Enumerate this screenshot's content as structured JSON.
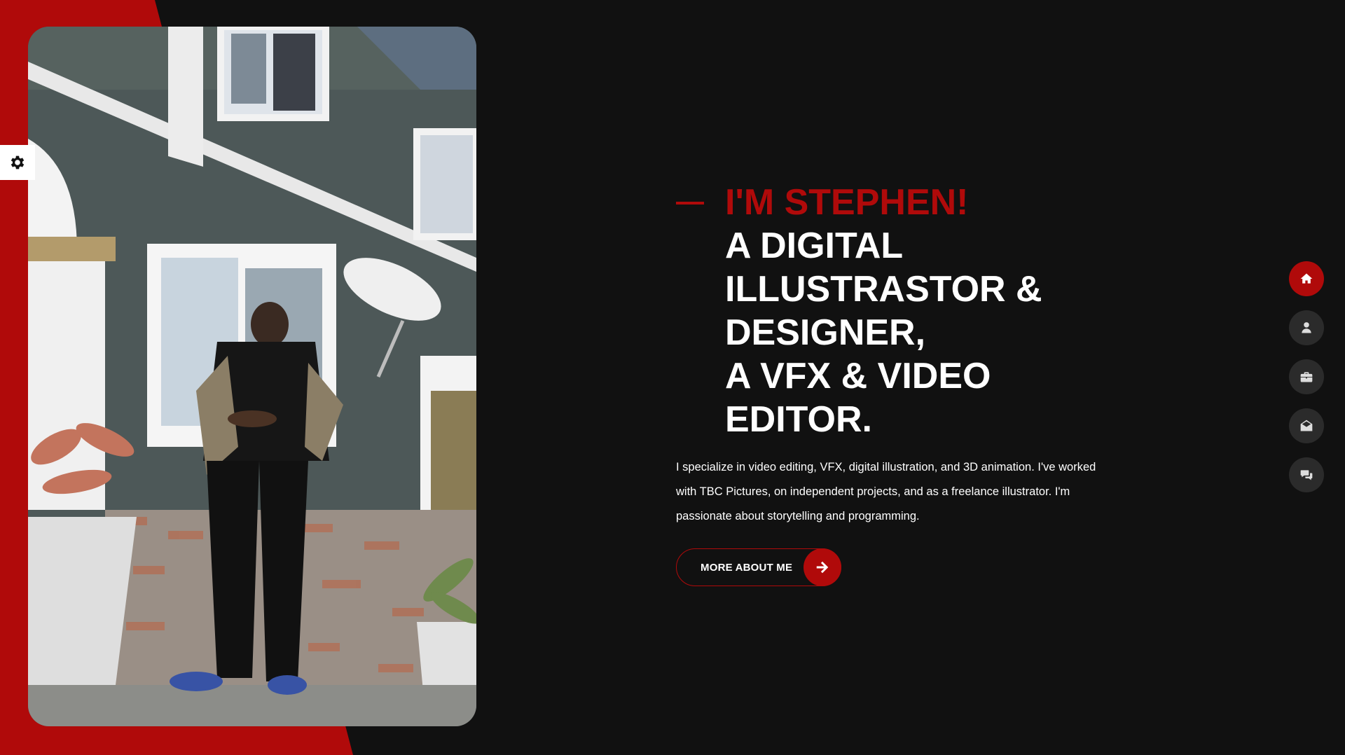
{
  "hero": {
    "greeting": "I'M STEPHEN!",
    "title_lines": [
      "A DIGITAL",
      "ILLUSTRASTOR &",
      "DESIGNER,",
      "A VFX & VIDEO",
      "EDITOR."
    ],
    "intro_lines": [
      "I specialize in video editing, VFX, digital illustration, and 3D animation. I've worked",
      "with TBC Pictures, on independent projects, and as a freelance illustrator. I'm",
      "passionate about storytelling and programming."
    ],
    "cta_label": "MORE ABOUT ME",
    "cta_icon": "arrow-right-icon"
  },
  "settings": {
    "icon": "gear-icon"
  },
  "nav": {
    "items": [
      {
        "icon": "home-icon",
        "active": true
      },
      {
        "icon": "user-icon",
        "active": false
      },
      {
        "icon": "briefcase-icon",
        "active": false
      },
      {
        "icon": "envelope-icon",
        "active": false
      },
      {
        "icon": "chat-icon",
        "active": false
      }
    ]
  },
  "colors": {
    "accent": "#b00a0a",
    "background": "#111111",
    "nav_inactive": "#2b2b2b",
    "text": "#ffffff"
  }
}
